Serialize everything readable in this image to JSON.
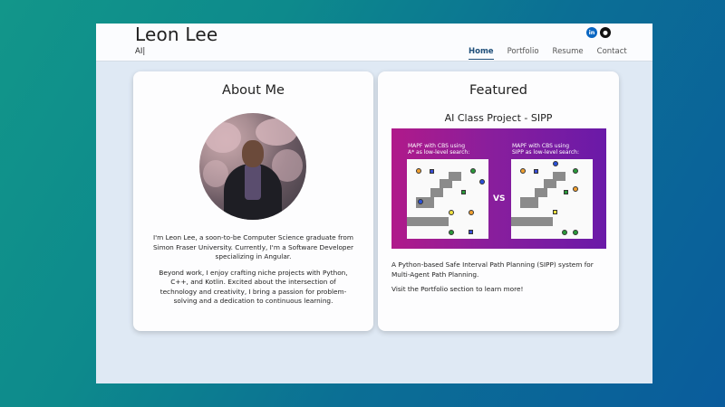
{
  "header": {
    "title": "Leon Lee",
    "subtitle": "AI|",
    "socials": [
      {
        "icon": "linkedin-icon",
        "glyph": "in"
      },
      {
        "icon": "github-icon",
        "glyph": "●"
      }
    ],
    "nav": [
      {
        "label": "Home",
        "active": true
      },
      {
        "label": "Portfolio",
        "active": false
      },
      {
        "label": "Resume",
        "active": false
      },
      {
        "label": "Contact",
        "active": false
      }
    ]
  },
  "about": {
    "title": "About Me",
    "paragraphs": [
      "I'm Leon Lee, a soon-to-be Computer Science graduate from Simon Fraser University. Currently, I'm a Software Developer specializing in Angular.",
      "Beyond work, I enjoy crafting niche projects with Python, C++, and Kotlin. Excited about the intersection of technology and creativity, I bring a passion for problem-solving and a dedication to continuous learning."
    ]
  },
  "featured": {
    "title": "Featured",
    "project_title": "AI Class Project - SIPP",
    "image": {
      "left_label": "MAPF with CBS using\nA* as low-level search:",
      "right_label": "MAPF with CBS using\nSIPP as low-level search:",
      "vs": "VS",
      "colors": {
        "purple": "#7a1aa0",
        "magenta": "#b01a8a"
      }
    },
    "paragraphs": [
      "A Python-based Safe Interval Path Planning (SIPP) system for Multi-Agent Path Planning.",
      "Visit the Portfolio section to learn more!"
    ]
  }
}
